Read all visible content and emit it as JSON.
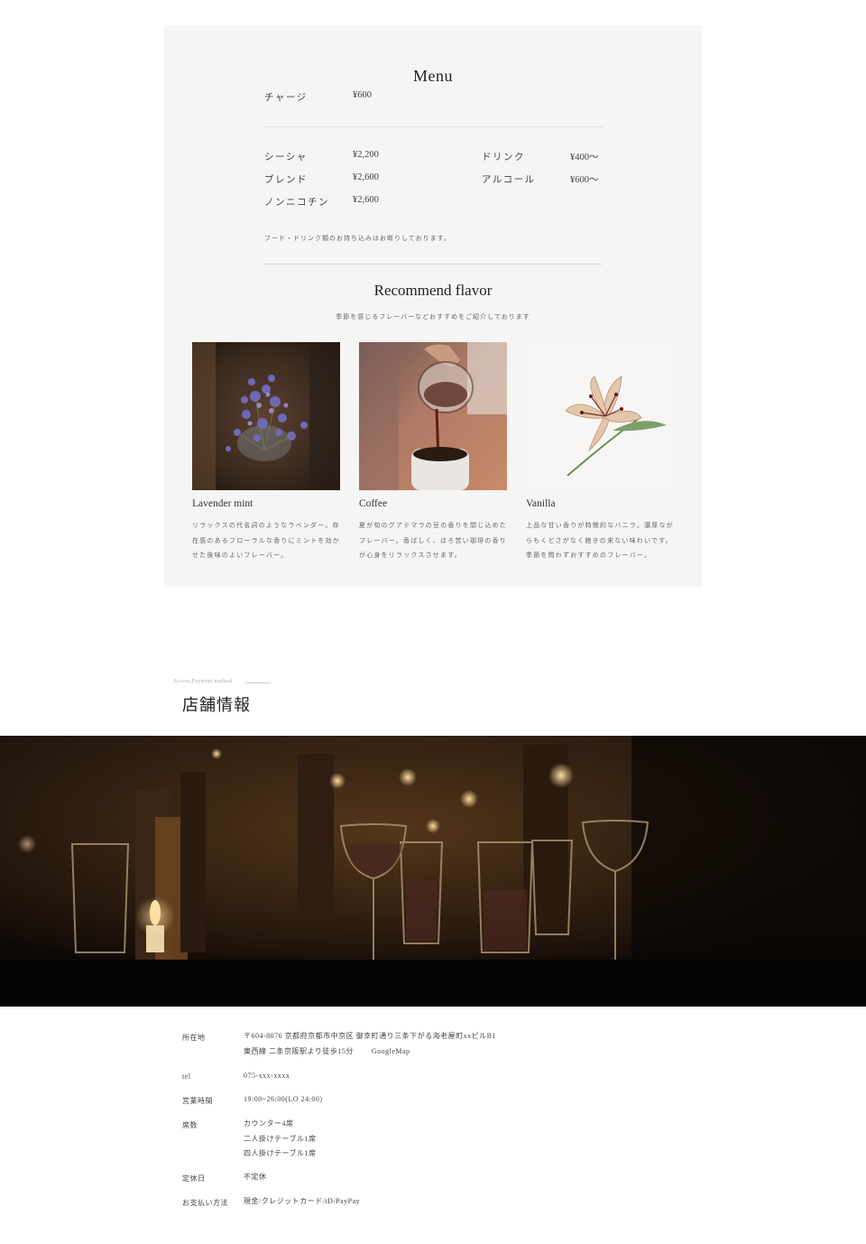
{
  "menu": {
    "title": "Menu",
    "charge": {
      "label": "チャージ",
      "price": "¥600"
    },
    "items_left": [
      {
        "label": "シーシャ",
        "price": "¥2,200"
      },
      {
        "label": "ブレンド",
        "price": "¥2,600"
      },
      {
        "label": "ノンニコチン",
        "price": "¥2,600"
      }
    ],
    "items_right": [
      {
        "label": "ドリンク",
        "price": "¥400〜"
      },
      {
        "label": "アルコール",
        "price": "¥600〜"
      }
    ],
    "note": "フード・ドリンク類のお持ち込みはお断りしております。"
  },
  "recommend": {
    "title": "Recommend flavor",
    "subtitle": "季節を感じるフレーバーなどおすすめをご紹介しております",
    "flavors": [
      {
        "name": "Lavender mint",
        "lines": [
          "リラックスの代名詞のようなラベンダー。存",
          "在感のあるフローラルな香りにミントを効か",
          "せた後味のよいフレーバー。"
        ]
      },
      {
        "name": "Coffee",
        "lines": [
          "夏が旬のグアテマラの豆の香りを閉じ込めた",
          "フレーバー。香ばしく、ほろ苦い珈琲の香り",
          "が心身をリラックスさせます。"
        ]
      },
      {
        "name": "Vanilla",
        "lines": [
          "上品な甘い香りが特徴的なバニラ。濃厚なが",
          "らもくどさがなく飽きの来ない味わいです。",
          "季節を問わずおすすめのフレーバー。"
        ]
      }
    ]
  },
  "shop": {
    "en_label": "Access,Payment method",
    "title": "店舗情報",
    "address_label": "所在地",
    "address_line1": "〒604-8076 京都府京都市中京区 御幸町通り三条下がる海老屋町xxビルB1",
    "address_line2": "東西線 二条京阪駅より徒歩15分",
    "gmap": "GoogleMap",
    "tel_label": "tel",
    "tel": "075-xxx-xxxx",
    "hours_label": "営業時間",
    "hours": "19:00~26:00(LO 24:00)",
    "seats_label": "席数",
    "seats": [
      "カウンター4席",
      "二人掛けテーブル1席",
      "四人掛けテーブル1席"
    ],
    "holiday_label": "定休日",
    "holiday": "不定休",
    "payment_label": "お支払い方法",
    "payment": "現金/クレジットカード/iD/PayPay"
  }
}
